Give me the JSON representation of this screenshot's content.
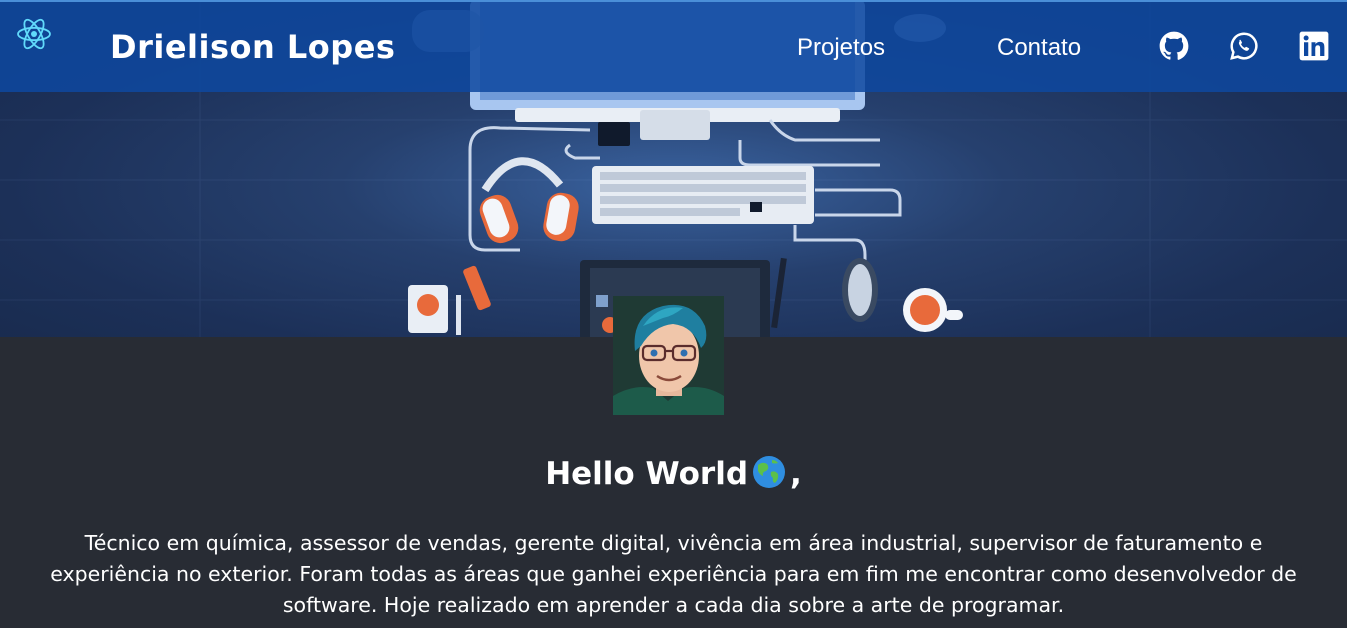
{
  "header": {
    "brand": "Drielison Lopes",
    "nav": [
      {
        "label": "Projetos"
      },
      {
        "label": "Contato"
      }
    ],
    "social": [
      "github-icon",
      "whatsapp-icon",
      "linkedin-icon"
    ],
    "logo": "react-logo-icon"
  },
  "hero": {
    "background": "desk-setup-illustration"
  },
  "profile": {
    "greeting": "Hello World",
    "greeting_suffix": ",",
    "emoji": "globe-emoji",
    "bio": "Técnico em química, assessor de vendas, gerente digital, vivência em área industrial, supervisor de faturamento e experiência no exterior. Foram todas as áreas que ganhei experiência para em fim me encontrar como desenvolvedor de software. Hoje realizado em aprender a cada dia sobre a arte de programar."
  },
  "colors": {
    "header_bg": "#0e48a0",
    "page_bg": "#282c34",
    "text": "#ffffff",
    "react_blue": "#61dafb"
  }
}
